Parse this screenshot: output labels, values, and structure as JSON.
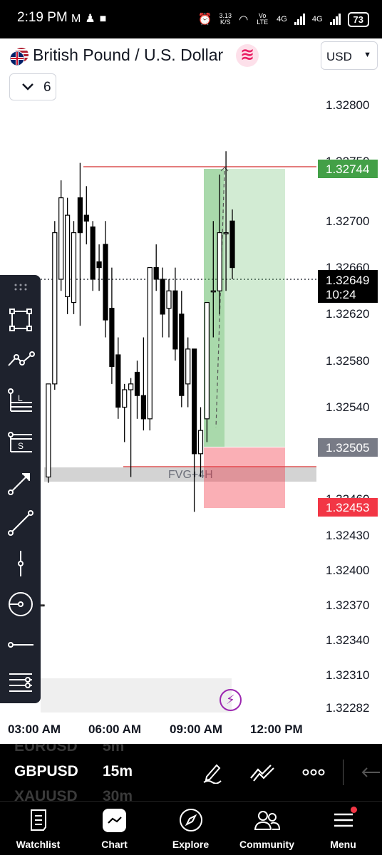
{
  "status_bar": {
    "time": "2:19 PM",
    "left_icons": [
      "gmail-icon",
      "snapchat-icon",
      "app-icon"
    ],
    "net_speed_value": "3.13",
    "net_speed_unit": "K/S",
    "volte_label": "Vo LTE",
    "network_1": "4G",
    "network_2": "4G",
    "battery": "73"
  },
  "header": {
    "pair_name": "British Pound / U.S. Dollar",
    "badge_symbol": "≋",
    "currency": "USD",
    "collapse_count": "6"
  },
  "chart": {
    "price_labels": [
      "1.32800",
      "1.32700",
      "1.32660",
      "1.32620",
      "1.32580",
      "1.32540",
      "1.32430",
      "1.32400",
      "1.32370",
      "1.32340",
      "1.32310",
      "1.32282"
    ],
    "partial_labels": [
      "1.32750",
      "1.32500",
      "1.32460"
    ],
    "take_profit_price": "1.32744",
    "current_price": "1.32649",
    "countdown": "10:24",
    "entry_price": "1.32505",
    "stop_loss_price": "1.32453",
    "fvg_label": "FVG+4H",
    "time_labels": [
      "03:00 AM",
      "06:00 AM",
      "09:00 AM",
      "12:00 PM"
    ],
    "colors": {
      "profit": "#4caf50",
      "loss": "#f23645",
      "line": "#d32f2f",
      "price_tag": "#000000",
      "entry_tag": "#787b86"
    }
  },
  "chart_data": {
    "type": "candlestick",
    "ylim": [
      1.32282,
      1.3282
    ],
    "candles": [
      {
        "o": 1.3237,
        "h": 1.3237,
        "l": 1.3237,
        "c": 1.3237
      },
      {
        "o": 1.3248,
        "h": 1.3256,
        "l": 1.32475,
        "c": 1.3256
      },
      {
        "o": 1.3256,
        "h": 1.327,
        "l": 1.32555,
        "c": 1.3269
      },
      {
        "o": 1.3265,
        "h": 1.32735,
        "l": 1.3264,
        "c": 1.3272
      },
      {
        "o": 1.32635,
        "h": 1.3272,
        "l": 1.3262,
        "c": 1.32705
      },
      {
        "o": 1.3263,
        "h": 1.327,
        "l": 1.3262,
        "c": 1.3269
      },
      {
        "o": 1.3272,
        "h": 1.3275,
        "l": 1.3261,
        "c": 1.3269
      },
      {
        "o": 1.32705,
        "h": 1.3273,
        "l": 1.3268,
        "c": 1.327
      },
      {
        "o": 1.32695,
        "h": 1.327,
        "l": 1.3264,
        "c": 1.3265
      },
      {
        "o": 1.32665,
        "h": 1.3268,
        "l": 1.3264,
        "c": 1.3266
      },
      {
        "o": 1.3268,
        "h": 1.327,
        "l": 1.326,
        "c": 1.32615
      },
      {
        "o": 1.32625,
        "h": 1.3266,
        "l": 1.3256,
        "c": 1.32575
      },
      {
        "o": 1.32585,
        "h": 1.326,
        "l": 1.3253,
        "c": 1.3254
      },
      {
        "o": 1.3254,
        "h": 1.3256,
        "l": 1.3251,
        "c": 1.32555
      },
      {
        "o": 1.32555,
        "h": 1.32565,
        "l": 1.3248,
        "c": 1.3256
      },
      {
        "o": 1.3257,
        "h": 1.3258,
        "l": 1.3253,
        "c": 1.3255
      },
      {
        "o": 1.3255,
        "h": 1.326,
        "l": 1.3252,
        "c": 1.3253
      },
      {
        "o": 1.3253,
        "h": 1.3266,
        "l": 1.3252,
        "c": 1.3266
      },
      {
        "o": 1.3266,
        "h": 1.3268,
        "l": 1.3264,
        "c": 1.3265
      },
      {
        "o": 1.3265,
        "h": 1.3266,
        "l": 1.326,
        "c": 1.3262
      },
      {
        "o": 1.32625,
        "h": 1.3265,
        "l": 1.326,
        "c": 1.3264
      },
      {
        "o": 1.3264,
        "h": 1.3266,
        "l": 1.3258,
        "c": 1.3259
      },
      {
        "o": 1.3262,
        "h": 1.3264,
        "l": 1.3254,
        "c": 1.3255
      },
      {
        "o": 1.3256,
        "h": 1.326,
        "l": 1.3254,
        "c": 1.3259
      },
      {
        "o": 1.3259,
        "h": 1.3259,
        "l": 1.3245,
        "c": 1.325
      },
      {
        "o": 1.325,
        "h": 1.3254,
        "l": 1.3248,
        "c": 1.3252
      },
      {
        "o": 1.3253,
        "h": 1.3263,
        "l": 1.3251,
        "c": 1.3263
      },
      {
        "o": 1.3264,
        "h": 1.327,
        "l": 1.326,
        "c": 1.3264
      },
      {
        "o": 1.3264,
        "h": 1.3274,
        "l": 1.3262,
        "c": 1.3269
      },
      {
        "o": 1.3269,
        "h": 1.3276,
        "l": 1.3264,
        "c": 1.3269
      },
      {
        "o": 1.327,
        "h": 1.3271,
        "l": 1.3265,
        "c": 1.3266
      }
    ],
    "levels": {
      "take_profit": 1.32744,
      "current": 1.32649,
      "entry": 1.32505,
      "stop_loss": 1.32453
    },
    "fvg_zone": [
      1.3247,
      1.3249
    ]
  },
  "toolbar": {
    "tools": [
      "drag-handle-icon",
      "rectangle-icon",
      "path-icon",
      "long-position-icon",
      "short-position-icon",
      "arrow-icon",
      "trend-line-icon",
      "vertical-line-icon",
      "brush-icon",
      "horizontal-ray-icon",
      "more-tools-icon"
    ]
  },
  "symbol_bar": {
    "prev_symbol": "EURUSD",
    "prev_interval": "5m",
    "symbol": "GBPUSD",
    "interval": "15m",
    "next_symbol": "XAUUSD",
    "next_interval": "30m"
  },
  "bottom_nav": {
    "items": [
      {
        "label": "Watchlist",
        "icon": "watchlist-icon"
      },
      {
        "label": "Chart",
        "icon": "chart-icon"
      },
      {
        "label": "Explore",
        "icon": "compass-icon"
      },
      {
        "label": "Community",
        "icon": "community-icon"
      },
      {
        "label": "Menu",
        "icon": "menu-icon"
      }
    ]
  }
}
